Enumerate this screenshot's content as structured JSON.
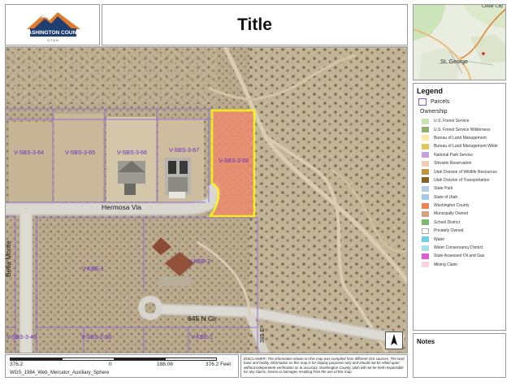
{
  "header": {
    "title": "Title",
    "logo": {
      "name": "WASHINGTON COUNTY",
      "sub": "UTAH"
    }
  },
  "overview_map": {
    "labels": {
      "top_right": "Cedar City",
      "city": "St. George"
    }
  },
  "map": {
    "streets": {
      "hermosa": "Hermosa Via",
      "cir": "645 N Cir",
      "bella": "Bella Monte",
      "east": "385 E"
    },
    "parcels": [
      "V-SBS-3-64",
      "V-SBS-3-65",
      "V-SBS-3-66",
      "V-SBS-3-67",
      "V-SBS-3-68",
      "V-KBE-1",
      "V-KBE-2",
      "V-SBS-3-45",
      "V-SBS-2-38",
      "V-KBE-1"
    ],
    "selected_parcel_color": "#f08a6e",
    "selected_outline_color": "#ffff00",
    "parcel_line_color": "#8f6ad6",
    "north_arrow": "north-arrow"
  },
  "legend": {
    "title": "Legend",
    "parcels_label": "Parcels",
    "ownership_label": "Ownership",
    "items": [
      {
        "label": "U.S. Forest Service",
        "color": "#c6e4b2"
      },
      {
        "label": "U.S. Forest Service Wilderness",
        "color": "#8fb06a"
      },
      {
        "label": "Bureau of Land Management",
        "color": "#ffe6a1"
      },
      {
        "label": "Bureau of Land Management Wilde",
        "color": "#e2c85a"
      },
      {
        "label": "National Park Service",
        "color": "#c9a0dd"
      },
      {
        "label": "Shivwits Reservation",
        "color": "#f0cdb3"
      },
      {
        "label": "Utah Division of Wildlife Resources",
        "color": "#c3963c"
      },
      {
        "label": "Utah Division of Transportation",
        "color": "#8a6120"
      },
      {
        "label": "State Park",
        "color": "#b3cde6"
      },
      {
        "label": "State of Utah",
        "color": "#a4c8e8"
      },
      {
        "label": "Washington County",
        "color": "#ee8350"
      },
      {
        "label": "Municipally Owned",
        "color": "#d6a07e"
      },
      {
        "label": "School District",
        "color": "#7fb86f"
      },
      {
        "label": "Privately Owned",
        "color": "#ffffff"
      },
      {
        "label": "Water",
        "color": "#6ecfe0"
      },
      {
        "label": "Water Conservancy District",
        "color": "#a8e0e8"
      },
      {
        "label": "State Assessed Oil and Gas",
        "color": "#e25ad6"
      },
      {
        "label": "Mining Claim",
        "color": "#fbd3dc"
      }
    ]
  },
  "notes": {
    "title": "Notes"
  },
  "scale": {
    "left": "376.2",
    "zero": "0",
    "mid": "188.08",
    "right": "376.2 Feet",
    "projection": "WGS_1984_Web_Mercator_Auxiliary_Sphere"
  },
  "disclaimer": "DISCLAIMER: The information shown on this map was compiled from different GIS sources. The land base and facility information on this map is for display purposes only and should not be relied upon without independent verification as to accuracy. Washington County, Utah will not be held responsible for any claims, losses or damages resulting from the use of this map."
}
